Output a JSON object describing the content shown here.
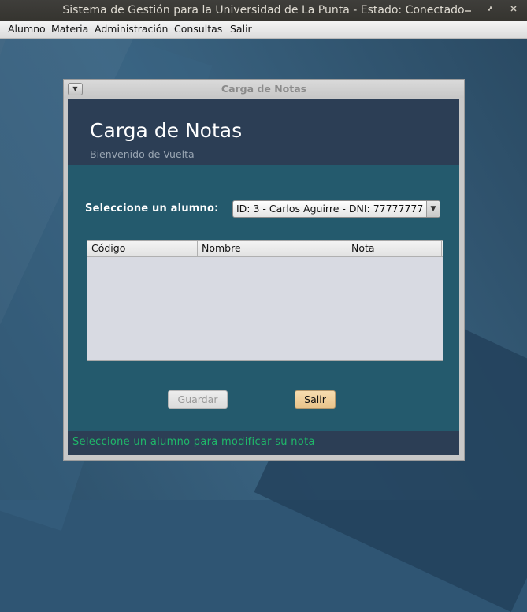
{
  "window": {
    "title": "Sistema de Gestión para la Universidad de La Punta - Estado: Conectado",
    "minimize_icon": "minimize-icon",
    "maximize_icon": "restore-icon",
    "close_icon": "close-icon"
  },
  "menubar": {
    "items": [
      {
        "label": "Alumno"
      },
      {
        "label": "Materia"
      },
      {
        "label": "Administración"
      },
      {
        "label": "Consultas"
      },
      {
        "label": "Salir"
      }
    ]
  },
  "internal_frame": {
    "title": "Carga de Notas",
    "header": {
      "title": "Carga de Notas",
      "subtitle": "Bienvenido de Vuelta"
    },
    "select": {
      "label": "Seleccione un alumno:",
      "value": "ID: 3 - Carlos Aguirre - DNI: 77777777"
    },
    "table": {
      "columns": [
        "Código",
        "Nombre",
        "Nota"
      ],
      "rows": []
    },
    "buttons": {
      "guardar": "Guardar",
      "salir": "Salir"
    },
    "status": "Seleccione un alumno para modificar su nota"
  },
  "colors": {
    "content_bg": "#245a6d",
    "header_bg": "#2c3e55",
    "status_text": "#1fb86a",
    "salir_button": "#efcf9c"
  }
}
